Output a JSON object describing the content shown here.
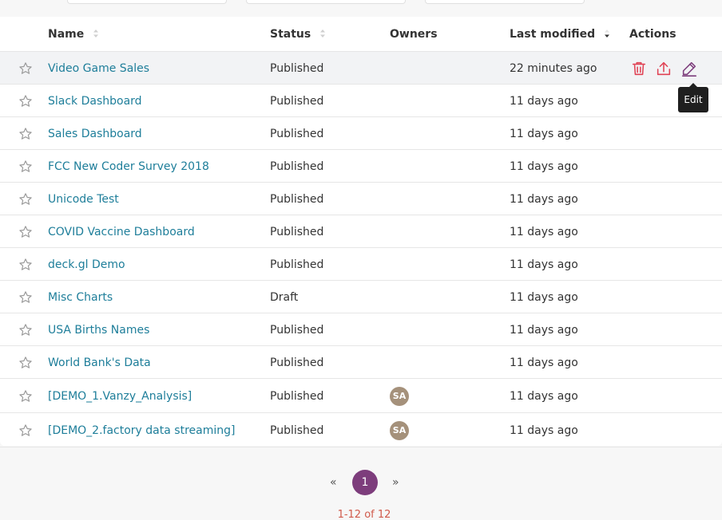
{
  "table": {
    "headers": {
      "name": "Name",
      "status": "Status",
      "owners": "Owners",
      "last_modified": "Last modified",
      "actions": "Actions"
    },
    "rows": [
      {
        "name": "Video Game Sales",
        "status": "Published",
        "owner": "",
        "modified": "22 minutes ago"
      },
      {
        "name": "Slack Dashboard",
        "status": "Published",
        "owner": "",
        "modified": "11 days ago"
      },
      {
        "name": "Sales Dashboard",
        "status": "Published",
        "owner": "",
        "modified": "11 days ago"
      },
      {
        "name": "FCC New Coder Survey 2018",
        "status": "Published",
        "owner": "",
        "modified": "11 days ago"
      },
      {
        "name": "Unicode Test",
        "status": "Published",
        "owner": "",
        "modified": "11 days ago"
      },
      {
        "name": "COVID Vaccine Dashboard",
        "status": "Published",
        "owner": "",
        "modified": "11 days ago"
      },
      {
        "name": "deck.gl Demo",
        "status": "Published",
        "owner": "",
        "modified": "11 days ago"
      },
      {
        "name": "Misc Charts",
        "status": "Draft",
        "owner": "",
        "modified": "11 days ago"
      },
      {
        "name": "USA Births Names",
        "status": "Published",
        "owner": "",
        "modified": "11 days ago"
      },
      {
        "name": "World Bank's Data",
        "status": "Published",
        "owner": "",
        "modified": "11 days ago"
      },
      {
        "name": "[DEMO_1.Vanzy_Analysis]",
        "status": "Published",
        "owner": "SA",
        "modified": "11 days ago"
      },
      {
        "name": "[DEMO_2.factory data streaming]",
        "status": "Published",
        "owner": "SA",
        "modified": "11 days ago"
      }
    ]
  },
  "tooltip": {
    "text": "Edit"
  },
  "pagination": {
    "prev": "«",
    "current": "1",
    "next": "»",
    "range_text": "1-12 of 12"
  },
  "colors": {
    "link": "#1e7e9a",
    "delete_icon": "#e04355",
    "export_icon": "#e04355",
    "edit_icon": "#7d3d7c",
    "page_active": "#7d3d7c",
    "avatar": "#a5917b"
  },
  "icons": {
    "favorite": "star-outline-icon",
    "delete": "trash-icon",
    "export": "upload-icon",
    "edit": "pencil-icon",
    "sort": "sort-icon"
  }
}
